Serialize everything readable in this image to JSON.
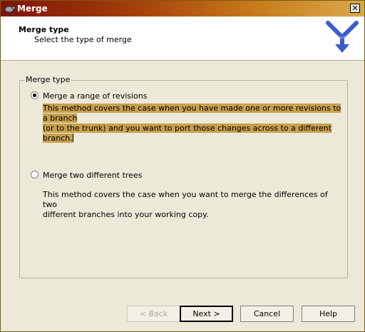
{
  "window": {
    "title": "Merge",
    "close_glyph": "✕"
  },
  "header": {
    "title": "Merge type",
    "subtitle": "Select the type of merge"
  },
  "group": {
    "label": "Merge type",
    "options": [
      {
        "label": "Merge a range of revisions",
        "selected": true,
        "description_lines": [
          "This method covers the case when you have made one or more revisions to a branch",
          "(or to the trunk) and you want to port those changes across to a different branch."
        ]
      },
      {
        "label": "Merge two different trees",
        "selected": false,
        "description_lines": [
          "This method covers the case when you want to merge the differences of two",
          "different branches into your working copy."
        ]
      }
    ]
  },
  "buttons": {
    "back": "< Back",
    "next": "Next >",
    "cancel": "Cancel",
    "help": "Help"
  },
  "colors": {
    "highlight": "#c8a04e",
    "title_start": "#7e1407",
    "title_end": "#d9a94d",
    "logo_arrow": "#3a5ccc"
  },
  "icons": {
    "app": "tortoise-icon",
    "logo": "merge-arrow-icon"
  }
}
